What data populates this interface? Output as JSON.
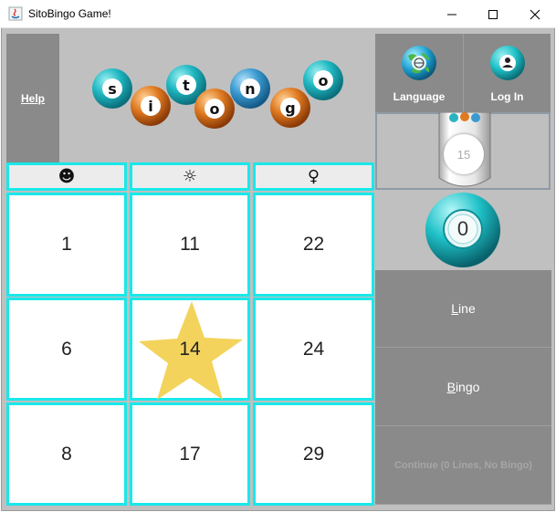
{
  "window": {
    "title": "SitoBingo Game!",
    "app_icon": "java-icon"
  },
  "help": {
    "label": "Help"
  },
  "logo": {
    "letters": [
      "s",
      "i",
      "t",
      "o",
      "n",
      "g",
      "o"
    ],
    "colors": [
      "#20b6c0",
      "#e07a20",
      "#20b6c0",
      "#e07a20",
      "#3a9ad0",
      "#e07a20",
      "#20b6c0"
    ]
  },
  "top_buttons": {
    "language": {
      "label": "Language",
      "icon": "globe-icon"
    },
    "login": {
      "label": "Log In",
      "icon": "user-icon"
    }
  },
  "tube": {
    "last_ball": "15"
  },
  "current_ball": {
    "value": "0"
  },
  "actions": {
    "line": {
      "label_u": "L",
      "label_rest": "ine"
    },
    "bingo": {
      "label_u": "B",
      "label_rest": "ingo"
    },
    "continue": {
      "label": "Continue (0 Lines, No Bingo)",
      "enabled": false
    }
  },
  "headers": [
    {
      "symbol": "☻",
      "icon": "smiley-icon"
    },
    {
      "symbol": "☼",
      "icon": "sun-icon"
    },
    {
      "symbol": "♀",
      "icon": "female-icon"
    }
  ],
  "card": [
    [
      "1",
      "11",
      "22"
    ],
    [
      "6",
      "14",
      "24"
    ],
    [
      "8",
      "17",
      "29"
    ]
  ],
  "marked_cell": "14",
  "colors": {
    "accent": "#19e8ea",
    "star": "#f3d35c",
    "panel": "#8a8a8a",
    "ball_teal": "#1fc2c8"
  }
}
